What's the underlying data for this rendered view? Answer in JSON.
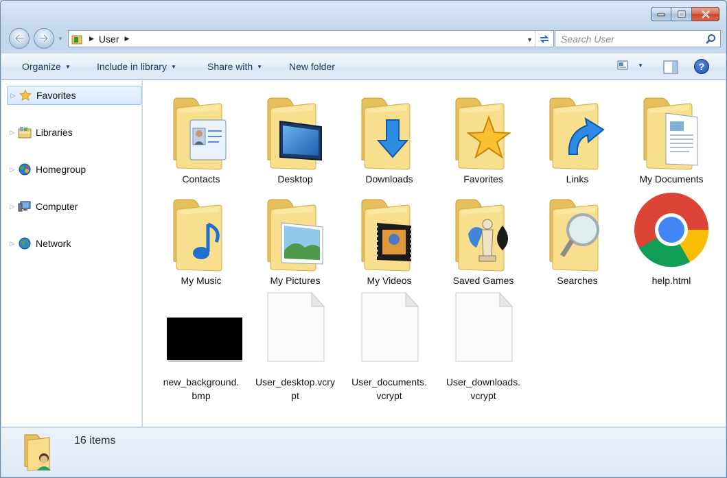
{
  "window": {
    "caption": {
      "minimize": "minimize",
      "maximize": "maximize",
      "close": "close"
    }
  },
  "address": {
    "path": "User"
  },
  "search": {
    "placeholder": "Search User"
  },
  "toolbar": {
    "organize": "Organize",
    "include_in_library": "Include in library",
    "share_with": "Share with",
    "new_folder": "New folder"
  },
  "sidebar": {
    "items": [
      {
        "label": "Favorites",
        "icon": "star-icon"
      },
      {
        "label": "Libraries",
        "icon": "libraries-icon"
      },
      {
        "label": "Homegroup",
        "icon": "homegroup-icon"
      },
      {
        "label": "Computer",
        "icon": "computer-icon"
      },
      {
        "label": "Network",
        "icon": "network-icon"
      }
    ]
  },
  "files": [
    {
      "label": "Contacts",
      "type": "folder",
      "overlay": "contacts"
    },
    {
      "label": "Desktop",
      "type": "folder",
      "overlay": "desktop"
    },
    {
      "label": "Downloads",
      "type": "folder",
      "overlay": "downloads"
    },
    {
      "label": "Favorites",
      "type": "folder",
      "overlay": "favorites"
    },
    {
      "label": "Links",
      "type": "folder",
      "overlay": "links"
    },
    {
      "label": "My Documents",
      "type": "folder",
      "overlay": "documents"
    },
    {
      "label": "My Music",
      "type": "folder",
      "overlay": "music"
    },
    {
      "label": "My Pictures",
      "type": "folder",
      "overlay": "pictures"
    },
    {
      "label": "My Videos",
      "type": "folder",
      "overlay": "videos"
    },
    {
      "label": "Saved Games",
      "type": "folder",
      "overlay": "games"
    },
    {
      "label": "Searches",
      "type": "folder",
      "overlay": "searches"
    },
    {
      "label": "help.html",
      "type": "chrome"
    },
    {
      "label": "new_background.\nbmp",
      "type": "bitmap"
    },
    {
      "label": "User_desktop.vcry\npt",
      "type": "file"
    },
    {
      "label": "User_documents.\nvcrypt",
      "type": "file"
    },
    {
      "label": "User_downloads.\nvcrypt",
      "type": "file"
    }
  ],
  "status": {
    "count": "16 items"
  },
  "colors": {
    "folder": "#f5d67c",
    "folder_dark": "#e2b850",
    "accent": "#1e395b",
    "selection": "#d7e8fb"
  }
}
